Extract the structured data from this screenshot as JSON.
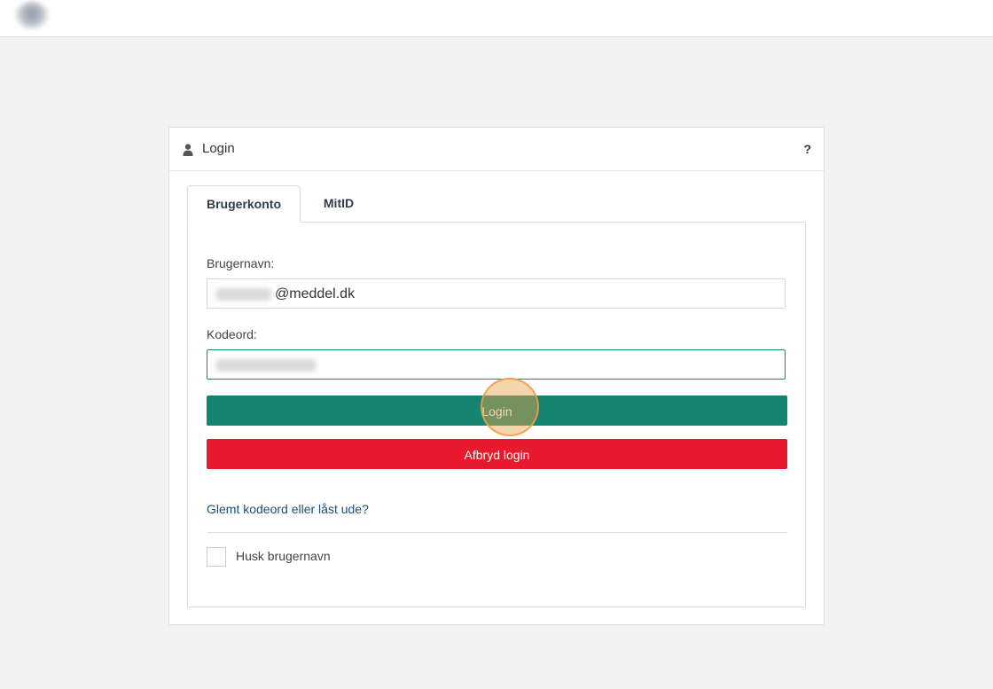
{
  "header": {
    "title": "Login",
    "help": "?"
  },
  "tabs": [
    {
      "label": "Brugerkonto",
      "active": true
    },
    {
      "label": "MitID",
      "active": false
    }
  ],
  "form": {
    "username_label": "Brugernavn:",
    "username_value": "@meddel.dk",
    "password_label": "Kodeord:",
    "login_label": "Login",
    "cancel_label": "Afbryd login",
    "forgot_link": "Glemt kodeord eller låst ude?",
    "remember_label": "Husk brugernavn",
    "remember_checked": false
  },
  "colors": {
    "login_button": "#148570",
    "cancel_button": "#e8192c",
    "link": "#1d4e7a",
    "focus_border": "#1a8a73"
  },
  "icons": {
    "header": "user-icon",
    "help": "help-icon",
    "logo": "blurred-logo"
  }
}
